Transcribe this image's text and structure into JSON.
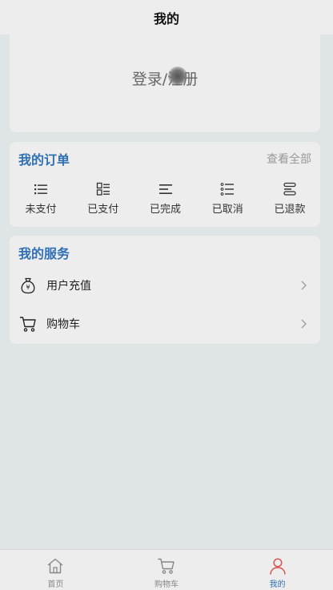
{
  "header": {
    "title": "我的"
  },
  "profile": {
    "login_label": "登录/注册"
  },
  "orders": {
    "title": "我的订单",
    "view_all": "查看全部",
    "items": [
      {
        "label": "未支付",
        "icon": "list-icon"
      },
      {
        "label": "已支付",
        "icon": "grid-list-icon"
      },
      {
        "label": "已完成",
        "icon": "align-left-icon"
      },
      {
        "label": "已取消",
        "icon": "checklist-icon"
      },
      {
        "label": "已退款",
        "icon": "refund-icon"
      }
    ]
  },
  "services": {
    "title": "我的服务",
    "items": [
      {
        "label": "用户充值",
        "icon": "money-bag-icon"
      },
      {
        "label": "购物车",
        "icon": "cart-icon"
      }
    ]
  },
  "tabbar": {
    "items": [
      {
        "label": "首页",
        "icon": "home-icon",
        "active": false
      },
      {
        "label": "购物车",
        "icon": "cart-icon",
        "active": false
      },
      {
        "label": "我的",
        "icon": "user-icon",
        "active": true
      }
    ],
    "active_color": "#2f6fb3",
    "active_icon_color": "#d9534f"
  },
  "colors": {
    "accent": "#2f6fb3",
    "background": "#dfe5e6",
    "card": "#ededed"
  }
}
